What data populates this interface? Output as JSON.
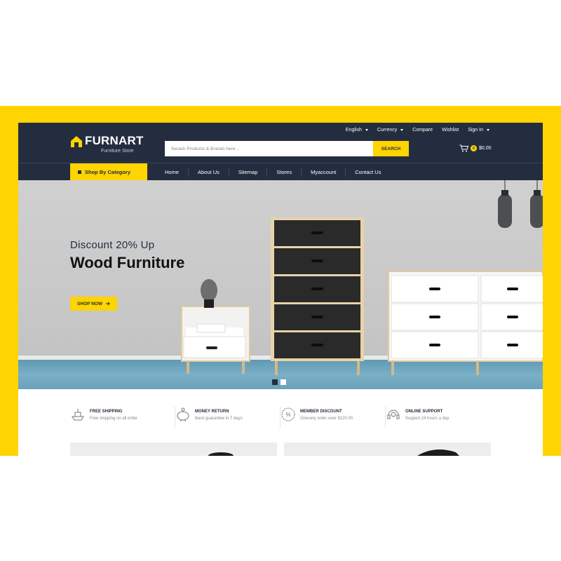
{
  "brand": {
    "name": "FURNART",
    "tagline": "Furniture Store"
  },
  "top_links": [
    {
      "label": "English",
      "dropdown": true
    },
    {
      "label": "Currency",
      "dropdown": true
    },
    {
      "label": "Compare",
      "dropdown": false
    },
    {
      "label": "Wishlist",
      "dropdown": false
    },
    {
      "label": "Sign In",
      "dropdown": true
    }
  ],
  "search": {
    "placeholder": "Serach Products & Brands here...",
    "button_label": "SEARCH"
  },
  "cart": {
    "count": "0",
    "total": "$0.00"
  },
  "nav": {
    "category_button": "Shop By Category",
    "items": [
      "Home",
      "About Us",
      "Sitemap",
      "Stores",
      "Myaccount",
      "Contact Us"
    ]
  },
  "hero": {
    "subtitle": "Discount 20% Up",
    "title": "Wood Furniture",
    "cta_label": "SHOP NOW",
    "slides": 2,
    "active_slide": 1
  },
  "features": [
    {
      "icon": "ship-icon",
      "title": "FREE SHIPPING",
      "desc": "Free shipping on all order"
    },
    {
      "icon": "piggy-bank-icon",
      "title": "MONEY RETURN",
      "desc": "Back guarantee in 7 days"
    },
    {
      "icon": "discount-badge-icon",
      "title": "MEMBER DISCOUNT",
      "desc": "Onevery order over $120.00"
    },
    {
      "icon": "headset-icon",
      "title": "ONLINE SUPPORT",
      "desc": "Support 24 hours a day"
    }
  ],
  "colors": {
    "accent": "#ffd400",
    "header": "#232d3f",
    "floor": "#6aa2ba"
  }
}
